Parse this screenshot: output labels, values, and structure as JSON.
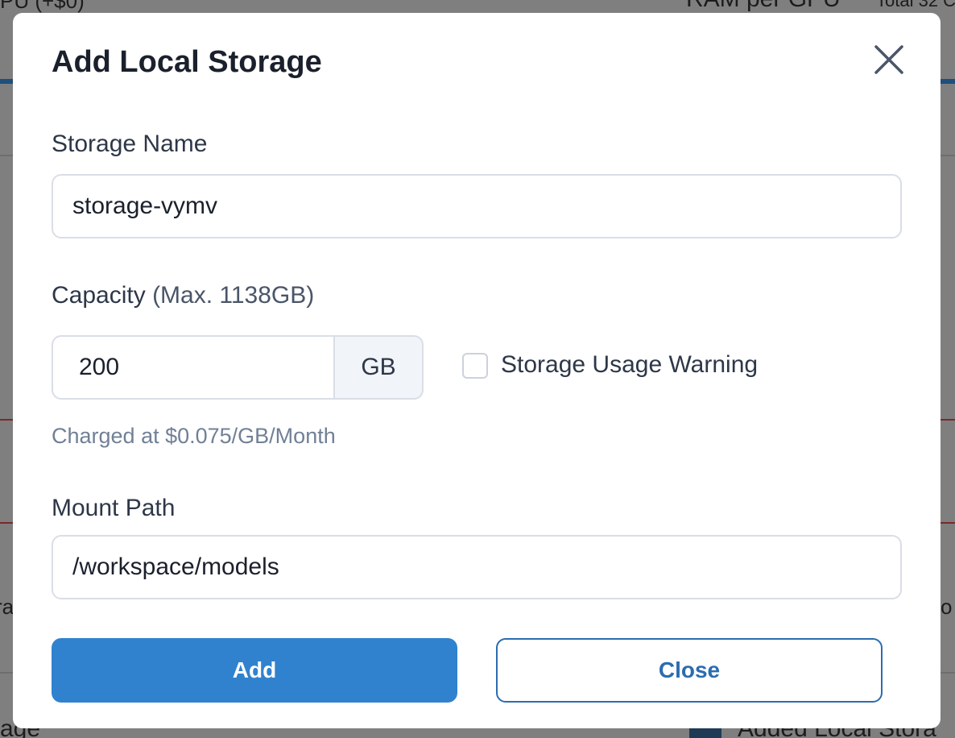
{
  "background": {
    "top_left_text": "PU (+$0)",
    "top_mid_text": "RAM per GPU",
    "top_right_text": "Total 32 C",
    "left_mid_text": "ra",
    "right_mid_text": "o",
    "bottom_left_text": "age",
    "bottom_right_text": "Added Local Stora"
  },
  "modal": {
    "title": "Add Local Storage",
    "storage_name": {
      "label": "Storage Name",
      "value": "storage-vymv"
    },
    "capacity": {
      "label": "Capacity",
      "hint": "(Max. 1138GB)",
      "value": "200",
      "unit": "GB"
    },
    "usage_warning": {
      "label": "Storage Usage Warning",
      "checked": false
    },
    "charge_note": "Charged at $0.075/GB/Month",
    "mount_path": {
      "label": "Mount Path",
      "value": "/workspace/models"
    },
    "add_label": "Add",
    "close_label": "Close"
  },
  "colors": {
    "primary": "#3182ce",
    "primary_text": "#2b6cb0",
    "overlay": "#808080"
  }
}
